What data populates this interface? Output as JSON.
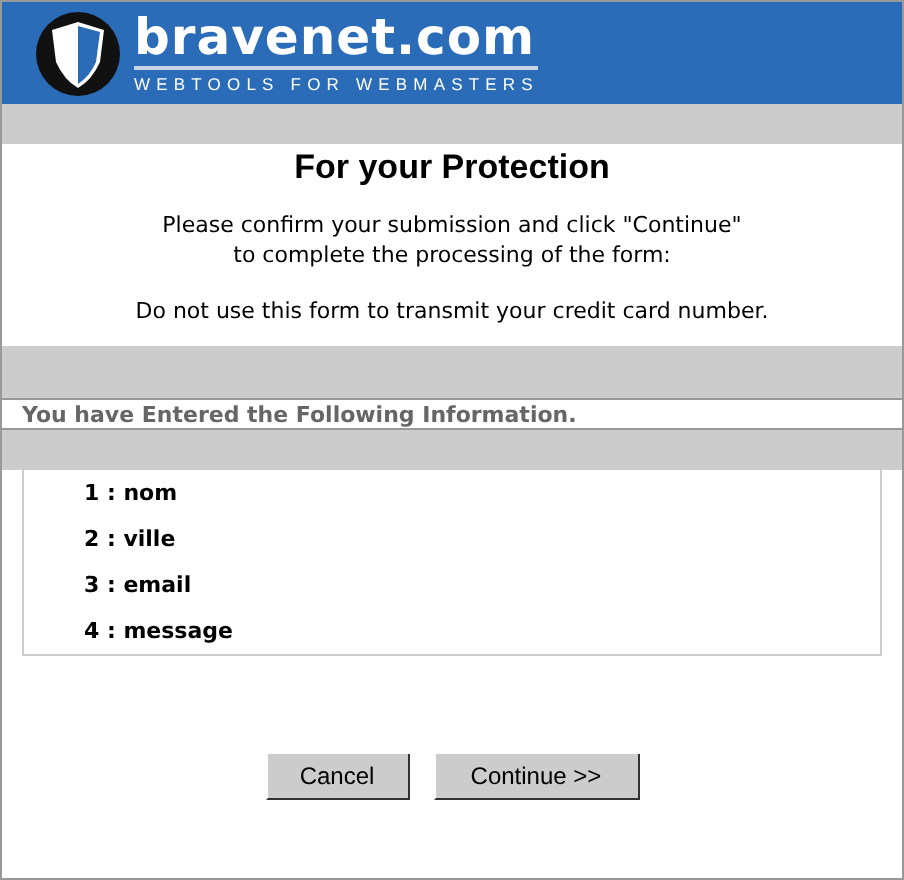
{
  "header": {
    "logo_name": "bravenet.com",
    "tagline": "WEBTOOLS FOR WEBMASTERS"
  },
  "notice": {
    "title": "For your Protection",
    "lines": [
      "Please confirm your submission and click \"Continue\"",
      "to complete the processing of the form:"
    ],
    "warning": "Do not use this form to transmit your credit card number."
  },
  "section_heading": "You have Entered the Following Information.",
  "fields": [
    "1 : nom",
    "2 : ville",
    "3 : email",
    "4 : message"
  ],
  "buttons": [
    {
      "label": "Cancel"
    },
    {
      "label": "Continue >>"
    }
  ]
}
